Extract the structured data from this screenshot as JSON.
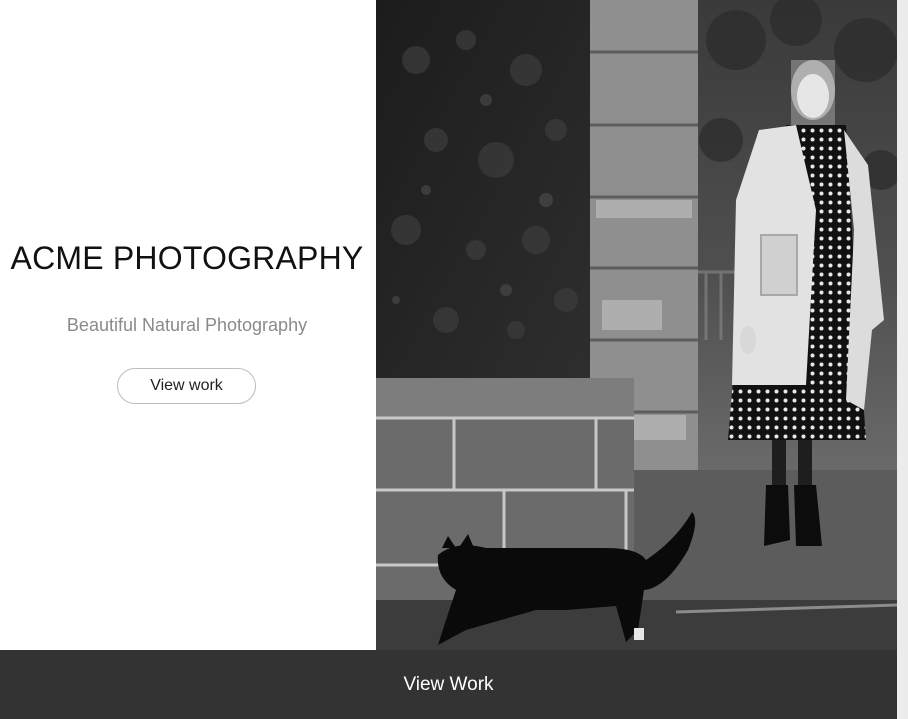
{
  "hero": {
    "title": "ACME PHOTOGRAPHY",
    "subtitle": "Beautiful Natural Photography",
    "button_label": "View work",
    "photo": {
      "description": "black-and-white photo: woman in coat and polka-dot dress standing by a stone pillar, black cat walking past"
    }
  },
  "footer": {
    "link_label": "View Work"
  },
  "colors": {
    "footer_background": "#333333",
    "subtitle_text": "#8a8a8a",
    "button_border": "#bdbdbd"
  }
}
